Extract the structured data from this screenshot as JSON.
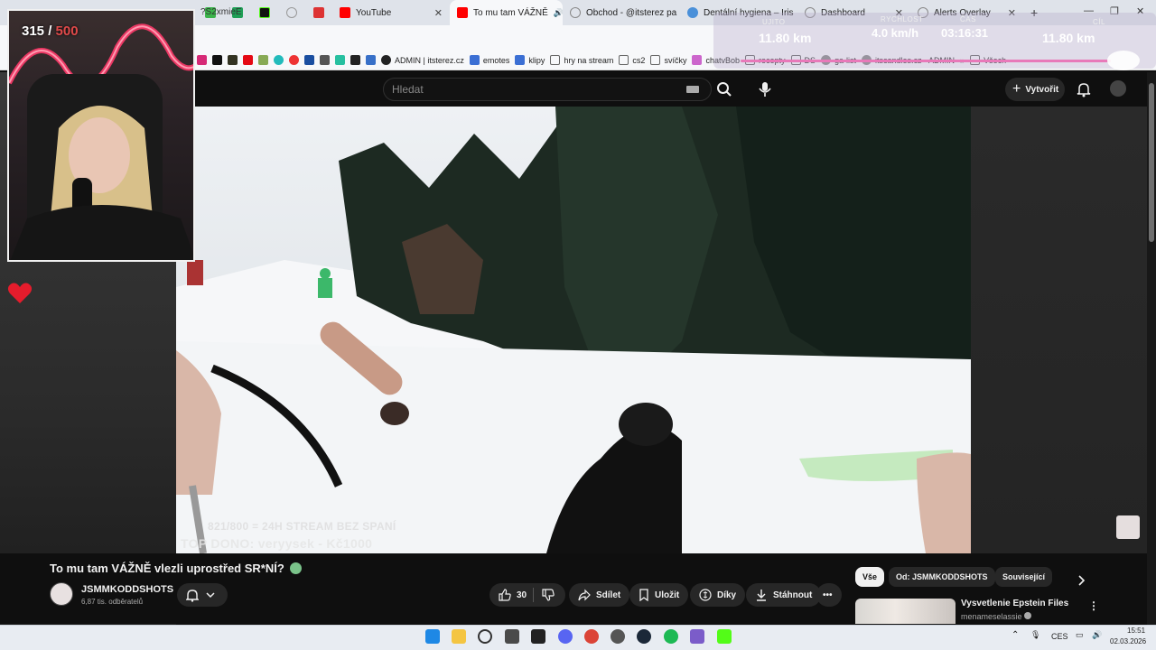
{
  "browser": {
    "tabs": [
      {
        "title": "YouTube"
      },
      {
        "title": "To mu tam VÁŽNĚ"
      },
      {
        "title": "Obchod - @itsterez pa"
      },
      {
        "title": "Dentální hygiena – Iris"
      },
      {
        "title": "Dashboard"
      },
      {
        "title": "Alerts Overlay"
      }
    ],
    "url": "?S2xmieE",
    "bookmarks": [
      "ADMIN | itsterez.cz",
      "emotes",
      "klipy",
      "hry na stream",
      "cs2",
      "svíčky",
      "chatvBob",
      "recepty",
      "DS",
      "ga-list",
      "itscandles.cz - ADMIN",
      "Všech"
    ]
  },
  "overlay": {
    "label_left": "UJITO",
    "distance_left": "11.80 km",
    "speed_label": "RYCHLOST",
    "speed": "4.0 km/h",
    "time_label": "ČAS",
    "time": "03:16:31",
    "goal_label": "CÍL",
    "distance_right": "11.80 km"
  },
  "webcam": {
    "current": "315",
    "separator": "/",
    "goal": "500"
  },
  "youtube": {
    "search_placeholder": "Hledat",
    "create_label": "Vytvořit",
    "video_overlay_line1": "821/800 = 24H STREAM BEZ SPANÍ",
    "video_overlay_line2": "TOP DONO: veryysek - Kč1000",
    "video_title": "To mu tam VÁŽNĚ vlezli uprostřed SR*NÍ?",
    "channel_name": "JSMMKODDSHOTS",
    "subscribers": "6,87 tis. odběratelů",
    "likes": "30",
    "share_label": "Sdílet",
    "save_label": "Uložit",
    "thanks_label": "Díky",
    "download_label": "Stáhnout",
    "chips": [
      "Vše",
      "Od: JSMMKODDSHOTS",
      "Související"
    ],
    "recommended_title": "Vysvetlenie Epstein Files",
    "recommended_channel": "menameselassie"
  },
  "taskbar": {
    "language": "CES",
    "time": "15:51",
    "date": "02.03.2026"
  },
  "colors": {
    "youtube_red": "#ff0000",
    "overlay_pink": "#e879b9",
    "yt_bg": "#0f0f0f",
    "pill_bg": "#272727"
  }
}
